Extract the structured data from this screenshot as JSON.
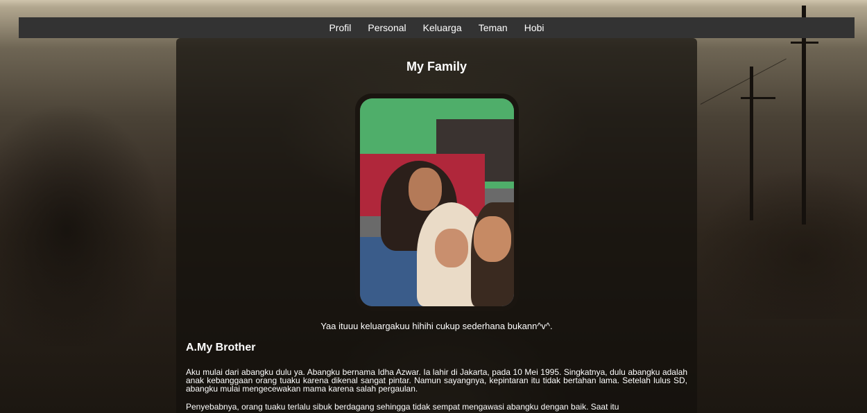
{
  "nav": {
    "items": [
      {
        "label": "Profil"
      },
      {
        "label": "Personal"
      },
      {
        "label": "Keluarga"
      },
      {
        "label": "Teman"
      },
      {
        "label": "Hobi"
      }
    ]
  },
  "main": {
    "title": "My Family",
    "photo_caption": "Yaa ituuu keluargakuu hihihi cukup sederhana bukann^v^.",
    "section_heading": "A.My Brother",
    "paragraphs": [
      "Aku mulai dari abangku dulu ya. Abangku bernama Idha Azwar. Ia lahir di Jakarta, pada 10 Mei 1995. Singkatnya, dulu abangku adalah anak kebanggaan orang tuaku karena dikenal sangat pintar. Namun sayangnya, kepintaran itu tidak bertahan lama. Setelah lulus SD, abangku mulai mengecewakan mama karena salah pergaulan.",
      "Penyebabnya, orang tuaku terlalu sibuk berdagang sehingga tidak sempat mengawasi abangku dengan baik. Saat itu"
    ]
  }
}
